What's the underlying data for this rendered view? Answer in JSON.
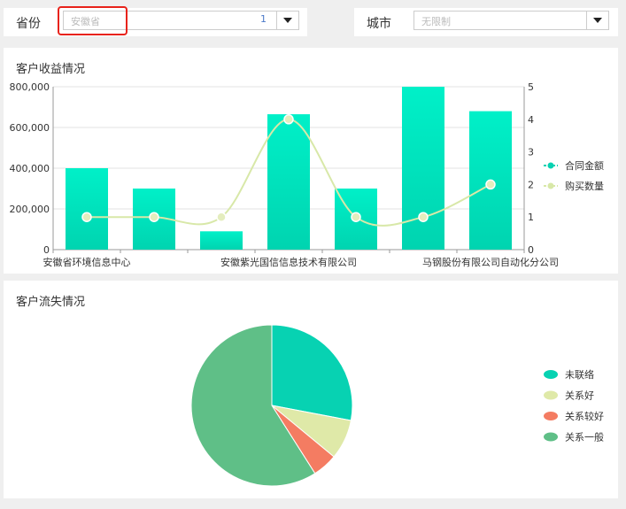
{
  "filters": {
    "province": {
      "label": "省份",
      "value": "安徽省",
      "count": "1"
    },
    "city": {
      "label": "城市",
      "placeholder": "无限制"
    }
  },
  "revenue_panel": {
    "title": "客户收益情况"
  },
  "churn_panel": {
    "title": "客户流失情况"
  },
  "colors": {
    "bar_top": "#00f0c8",
    "bar_bottom": "#00d4b0",
    "line": "#d8e8a8",
    "pie_1": "#07d2b2",
    "pie_2": "#dfe9a8",
    "pie_3": "#f47c62",
    "pie_4": "#5fbf87"
  },
  "chart_data": [
    {
      "type": "bar",
      "categories": [
        "安徽省环境信息中心",
        "",
        "",
        "安徽紫光国信信息技术有限公司",
        "",
        "",
        "马钢股份有限公司自动化分公司"
      ],
      "category_ticks": [
        "安徽省环境信息中心",
        "安徽紫光国信信息技术有限公司",
        "马钢股份有限公司自动化分公司"
      ],
      "series": [
        {
          "name": "合同金额",
          "type": "bar",
          "axis": "left",
          "values": [
            400000,
            300000,
            90000,
            665000,
            300000,
            800000,
            680000
          ]
        },
        {
          "name": "购买数量",
          "type": "line",
          "axis": "right",
          "values": [
            1,
            1,
            1,
            4,
            1,
            1,
            2
          ]
        }
      ],
      "y_left": {
        "min": 0,
        "max": 800000,
        "ticks": [
          "0",
          "200,000",
          "400,000",
          "600,000",
          "800,000"
        ]
      },
      "y_right": {
        "min": 0,
        "max": 5,
        "ticks": [
          "0",
          "1",
          "2",
          "3",
          "4",
          "5"
        ]
      },
      "legend_position": "right"
    },
    {
      "type": "pie",
      "labels": [
        "未联络",
        "关系好",
        "关系较好",
        "关系一般"
      ],
      "values": [
        28,
        8,
        5,
        59
      ],
      "legend_position": "right"
    }
  ]
}
